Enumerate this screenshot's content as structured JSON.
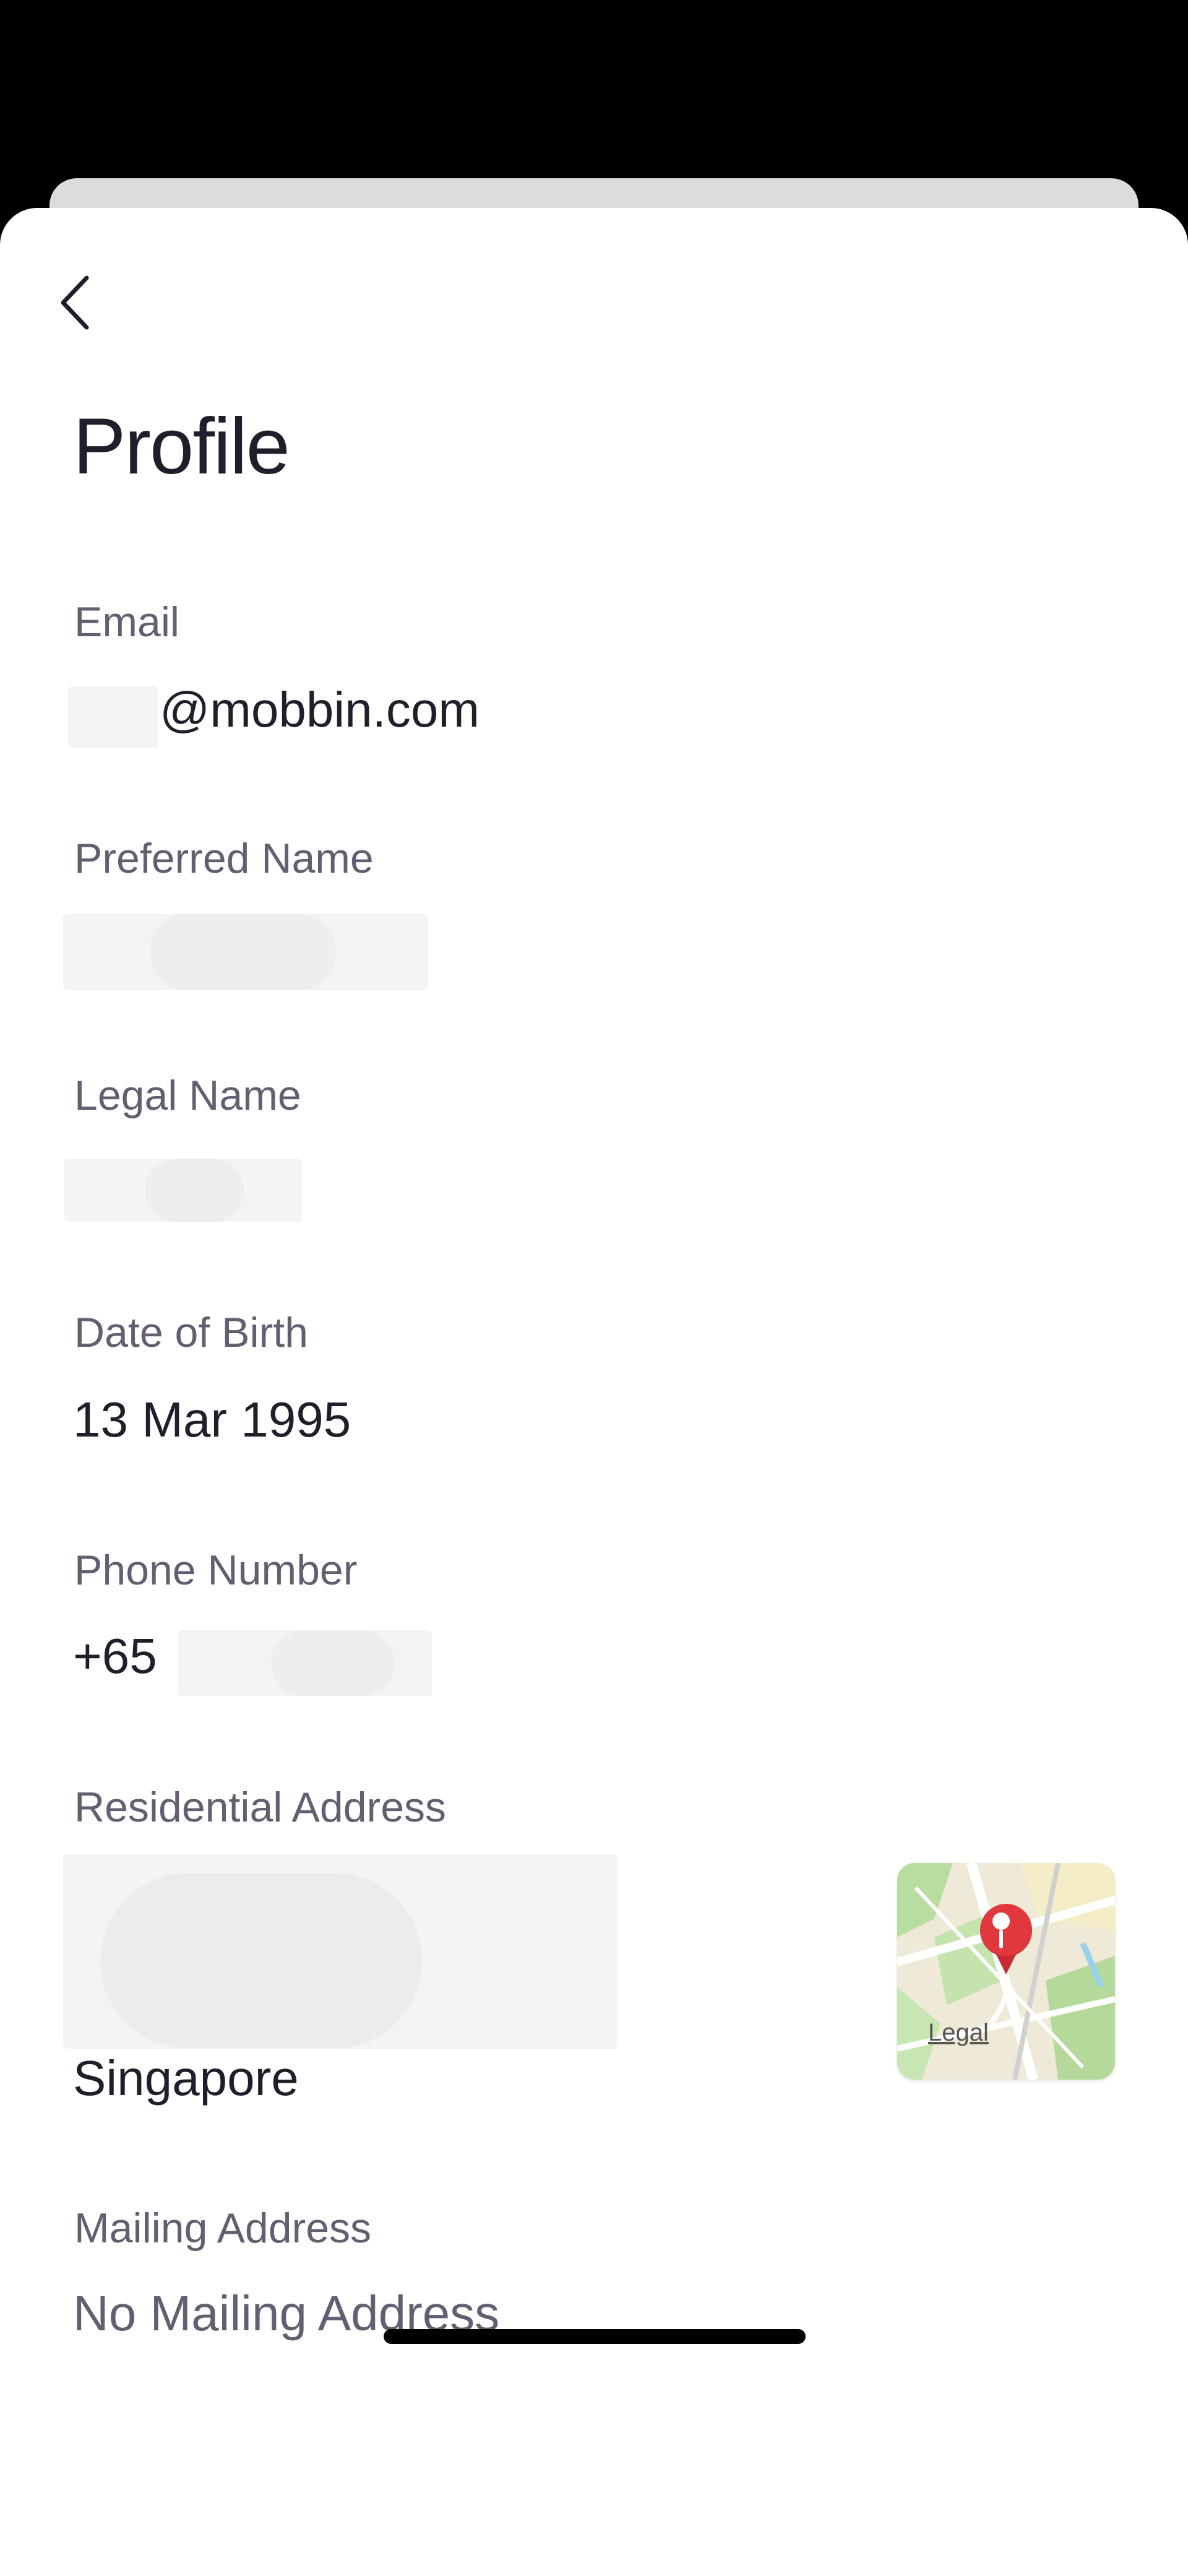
{
  "header": {
    "back_icon": "chevron-left-icon",
    "title": "Profile"
  },
  "fields": {
    "email": {
      "label": "Email",
      "value": "@mobbin.com"
    },
    "preferred_name": {
      "label": "Preferred Name"
    },
    "legal_name": {
      "label": "Legal Name"
    },
    "dob": {
      "label": "Date of Birth",
      "value": "13 Mar 1995"
    },
    "phone": {
      "label": "Phone Number",
      "prefix": "+65"
    },
    "residential": {
      "label": "Residential Address",
      "value": "Singapore",
      "map_legal": "Legal"
    },
    "mailing": {
      "label": "Mailing Address",
      "value": "No Mailing Address"
    }
  },
  "colors": {
    "pin": "#e0383c",
    "text_primary": "#1f1f2b",
    "text_secondary": "#5f6070"
  }
}
